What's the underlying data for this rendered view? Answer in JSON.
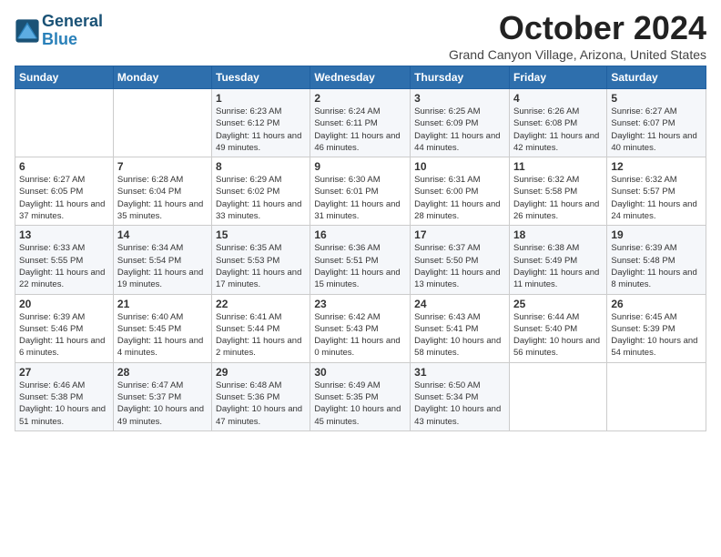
{
  "header": {
    "logo_line1": "General",
    "logo_line2": "Blue",
    "month_title": "October 2024",
    "subtitle": "Grand Canyon Village, Arizona, United States"
  },
  "days_of_week": [
    "Sunday",
    "Monday",
    "Tuesday",
    "Wednesday",
    "Thursday",
    "Friday",
    "Saturday"
  ],
  "weeks": [
    [
      {
        "day": "",
        "info": ""
      },
      {
        "day": "",
        "info": ""
      },
      {
        "day": "1",
        "info": "Sunrise: 6:23 AM\nSunset: 6:12 PM\nDaylight: 11 hours and 49 minutes."
      },
      {
        "day": "2",
        "info": "Sunrise: 6:24 AM\nSunset: 6:11 PM\nDaylight: 11 hours and 46 minutes."
      },
      {
        "day": "3",
        "info": "Sunrise: 6:25 AM\nSunset: 6:09 PM\nDaylight: 11 hours and 44 minutes."
      },
      {
        "day": "4",
        "info": "Sunrise: 6:26 AM\nSunset: 6:08 PM\nDaylight: 11 hours and 42 minutes."
      },
      {
        "day": "5",
        "info": "Sunrise: 6:27 AM\nSunset: 6:07 PM\nDaylight: 11 hours and 40 minutes."
      }
    ],
    [
      {
        "day": "6",
        "info": "Sunrise: 6:27 AM\nSunset: 6:05 PM\nDaylight: 11 hours and 37 minutes."
      },
      {
        "day": "7",
        "info": "Sunrise: 6:28 AM\nSunset: 6:04 PM\nDaylight: 11 hours and 35 minutes."
      },
      {
        "day": "8",
        "info": "Sunrise: 6:29 AM\nSunset: 6:02 PM\nDaylight: 11 hours and 33 minutes."
      },
      {
        "day": "9",
        "info": "Sunrise: 6:30 AM\nSunset: 6:01 PM\nDaylight: 11 hours and 31 minutes."
      },
      {
        "day": "10",
        "info": "Sunrise: 6:31 AM\nSunset: 6:00 PM\nDaylight: 11 hours and 28 minutes."
      },
      {
        "day": "11",
        "info": "Sunrise: 6:32 AM\nSunset: 5:58 PM\nDaylight: 11 hours and 26 minutes."
      },
      {
        "day": "12",
        "info": "Sunrise: 6:32 AM\nSunset: 5:57 PM\nDaylight: 11 hours and 24 minutes."
      }
    ],
    [
      {
        "day": "13",
        "info": "Sunrise: 6:33 AM\nSunset: 5:55 PM\nDaylight: 11 hours and 22 minutes."
      },
      {
        "day": "14",
        "info": "Sunrise: 6:34 AM\nSunset: 5:54 PM\nDaylight: 11 hours and 19 minutes."
      },
      {
        "day": "15",
        "info": "Sunrise: 6:35 AM\nSunset: 5:53 PM\nDaylight: 11 hours and 17 minutes."
      },
      {
        "day": "16",
        "info": "Sunrise: 6:36 AM\nSunset: 5:51 PM\nDaylight: 11 hours and 15 minutes."
      },
      {
        "day": "17",
        "info": "Sunrise: 6:37 AM\nSunset: 5:50 PM\nDaylight: 11 hours and 13 minutes."
      },
      {
        "day": "18",
        "info": "Sunrise: 6:38 AM\nSunset: 5:49 PM\nDaylight: 11 hours and 11 minutes."
      },
      {
        "day": "19",
        "info": "Sunrise: 6:39 AM\nSunset: 5:48 PM\nDaylight: 11 hours and 8 minutes."
      }
    ],
    [
      {
        "day": "20",
        "info": "Sunrise: 6:39 AM\nSunset: 5:46 PM\nDaylight: 11 hours and 6 minutes."
      },
      {
        "day": "21",
        "info": "Sunrise: 6:40 AM\nSunset: 5:45 PM\nDaylight: 11 hours and 4 minutes."
      },
      {
        "day": "22",
        "info": "Sunrise: 6:41 AM\nSunset: 5:44 PM\nDaylight: 11 hours and 2 minutes."
      },
      {
        "day": "23",
        "info": "Sunrise: 6:42 AM\nSunset: 5:43 PM\nDaylight: 11 hours and 0 minutes."
      },
      {
        "day": "24",
        "info": "Sunrise: 6:43 AM\nSunset: 5:41 PM\nDaylight: 10 hours and 58 minutes."
      },
      {
        "day": "25",
        "info": "Sunrise: 6:44 AM\nSunset: 5:40 PM\nDaylight: 10 hours and 56 minutes."
      },
      {
        "day": "26",
        "info": "Sunrise: 6:45 AM\nSunset: 5:39 PM\nDaylight: 10 hours and 54 minutes."
      }
    ],
    [
      {
        "day": "27",
        "info": "Sunrise: 6:46 AM\nSunset: 5:38 PM\nDaylight: 10 hours and 51 minutes."
      },
      {
        "day": "28",
        "info": "Sunrise: 6:47 AM\nSunset: 5:37 PM\nDaylight: 10 hours and 49 minutes."
      },
      {
        "day": "29",
        "info": "Sunrise: 6:48 AM\nSunset: 5:36 PM\nDaylight: 10 hours and 47 minutes."
      },
      {
        "day": "30",
        "info": "Sunrise: 6:49 AM\nSunset: 5:35 PM\nDaylight: 10 hours and 45 minutes."
      },
      {
        "day": "31",
        "info": "Sunrise: 6:50 AM\nSunset: 5:34 PM\nDaylight: 10 hours and 43 minutes."
      },
      {
        "day": "",
        "info": ""
      },
      {
        "day": "",
        "info": ""
      }
    ]
  ]
}
